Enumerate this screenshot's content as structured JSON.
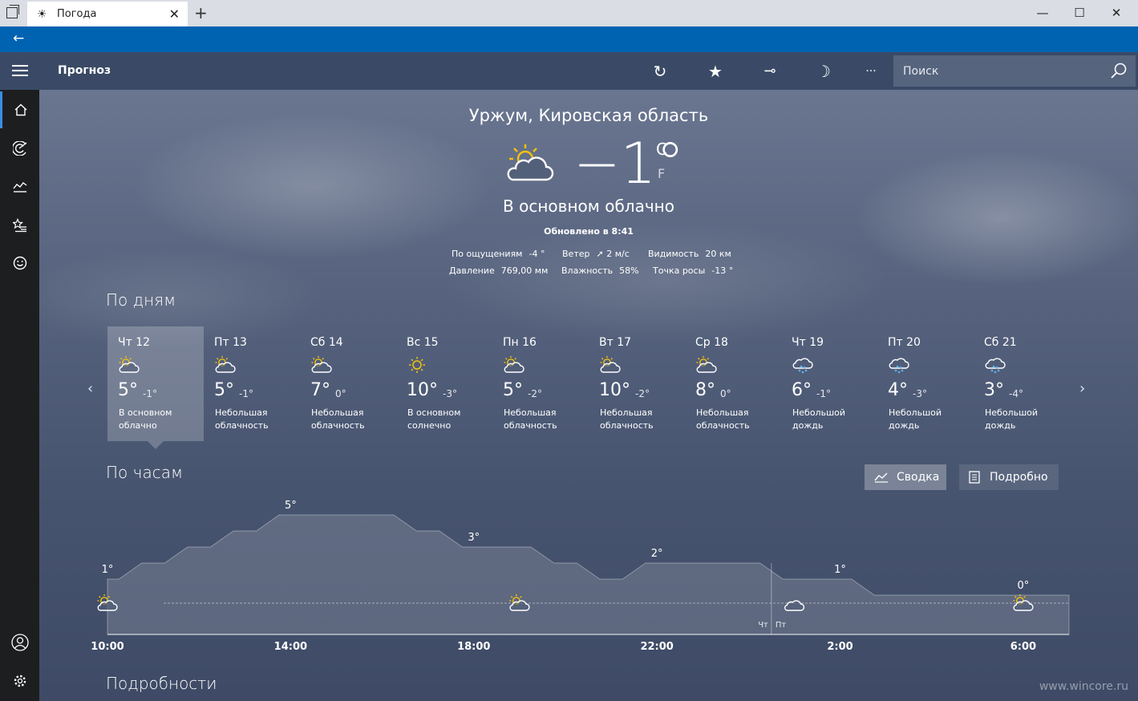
{
  "window": {
    "tab_title": "Погода",
    "new_tab_symbol": "+",
    "tab_close_symbol": "✕",
    "minimize_symbol": "—",
    "maximize_symbol": "☐",
    "close_symbol": "✕"
  },
  "navbar": {
    "back_symbol": "←"
  },
  "appbar": {
    "title": "Прогноз",
    "refresh_symbol": "↻",
    "favorite_symbol": "★",
    "pin_symbol": "⊸",
    "theme_symbol": "☽",
    "more_symbol": "···",
    "search_placeholder": "Поиск"
  },
  "sidebar": {
    "items": [
      {
        "name": "home-icon"
      },
      {
        "name": "radar-icon"
      },
      {
        "name": "history-icon"
      },
      {
        "name": "favorites-icon"
      },
      {
        "name": "smiley-icon"
      }
    ],
    "bottom": [
      {
        "name": "account-icon"
      },
      {
        "name": "settings-icon"
      }
    ]
  },
  "current": {
    "location": "Уржум, Кировская область",
    "temp": "−1°",
    "unit_c": "C",
    "unit_f": "F",
    "condition": "В основном облачно",
    "updated": "Обновлено в 8:41",
    "stats_row1": [
      {
        "label": "По ощущениям",
        "value": "-4 °"
      },
      {
        "label": "Ветер",
        "value": "➚ 2 м/с"
      },
      {
        "label": "Видимость",
        "value": "20 км"
      }
    ],
    "stats_row2": [
      {
        "label": "Давление",
        "value": "769,00 мм"
      },
      {
        "label": "Влажность",
        "value": "58%"
      },
      {
        "label": "Точка росы",
        "value": "-13 °"
      }
    ]
  },
  "daily": {
    "title": "По дням",
    "prev_symbol": "‹",
    "next_symbol": "›",
    "days": [
      {
        "name": "Чт 12",
        "hi": "5°",
        "lo": "-1°",
        "desc": "В основном облачно",
        "icon": "partly-cloudy-icon",
        "selected": true
      },
      {
        "name": "Пт 13",
        "hi": "5°",
        "lo": "-1°",
        "desc": "Небольшая облачность",
        "icon": "partly-cloudy-icon"
      },
      {
        "name": "Сб 14",
        "hi": "7°",
        "lo": "0°",
        "desc": "Небольшая облачность",
        "icon": "partly-cloudy-icon"
      },
      {
        "name": "Вс 15",
        "hi": "10°",
        "lo": "-3°",
        "desc": "В основном солнечно",
        "icon": "sunny-icon"
      },
      {
        "name": "Пн 16",
        "hi": "5°",
        "lo": "-2°",
        "desc": "Небольшая облачность",
        "icon": "partly-cloudy-icon"
      },
      {
        "name": "Вт 17",
        "hi": "10°",
        "lo": "-2°",
        "desc": "Небольшая облачность",
        "icon": "partly-cloudy-icon"
      },
      {
        "name": "Ср 18",
        "hi": "8°",
        "lo": "0°",
        "desc": "Небольшая облачность",
        "icon": "partly-cloudy-icon"
      },
      {
        "name": "Чт 19",
        "hi": "6°",
        "lo": "-1°",
        "desc": "Небольшой дождь",
        "icon": "rain-icon"
      },
      {
        "name": "Пт 20",
        "hi": "4°",
        "lo": "-3°",
        "desc": "Небольшой дождь",
        "icon": "rain-icon"
      },
      {
        "name": "Сб 21",
        "hi": "3°",
        "lo": "-4°",
        "desc": "Небольшой дождь",
        "icon": "rain-icon"
      }
    ]
  },
  "hourly": {
    "title": "По часам",
    "summary_label": "Сводка",
    "detail_label": "Подробно",
    "day_left": "Чт",
    "day_right": "Пт"
  },
  "details": {
    "title": "Подробности"
  },
  "watermark": "www.wincore.ru",
  "chart_data": {
    "type": "area",
    "title": "",
    "xlabel": "",
    "ylabel": "",
    "ylim": [
      -1,
      6
    ],
    "x": [
      "10:00",
      "11:00",
      "12:00",
      "13:00",
      "14:00",
      "15:00",
      "16:00",
      "17:00",
      "18:00",
      "19:00",
      "20:00",
      "21:00",
      "22:00",
      "23:00",
      "00:00",
      "1:00",
      "2:00",
      "3:00",
      "4:00",
      "5:00",
      "6:00",
      "7:00"
    ],
    "values": [
      1,
      2,
      3,
      4,
      5,
      5,
      5,
      4,
      3,
      3,
      2,
      1,
      2,
      2,
      2,
      1,
      1,
      0,
      0,
      0,
      0,
      0
    ],
    "x_tick_labels": [
      "10:00",
      "14:00",
      "18:00",
      "22:00",
      "2:00",
      "6:00"
    ],
    "point_labels": [
      {
        "x": "10:00",
        "text": "1°"
      },
      {
        "x": "14:00",
        "text": "5°"
      },
      {
        "x": "18:00",
        "text": "3°"
      },
      {
        "x": "22:00",
        "text": "2°"
      },
      {
        "x": "2:00",
        "text": "1°"
      },
      {
        "x": "6:00",
        "text": "0°"
      }
    ],
    "condition_icons": [
      {
        "x": "10:00",
        "icon": "partly-cloudy-icon"
      },
      {
        "x": "19:00",
        "icon": "partly-cloudy-icon"
      },
      {
        "x": "1:00",
        "icon": "cloudy-icon"
      },
      {
        "x": "6:00",
        "icon": "partly-cloudy-icon"
      }
    ],
    "day_divider_after": "00:00",
    "grid": false
  }
}
